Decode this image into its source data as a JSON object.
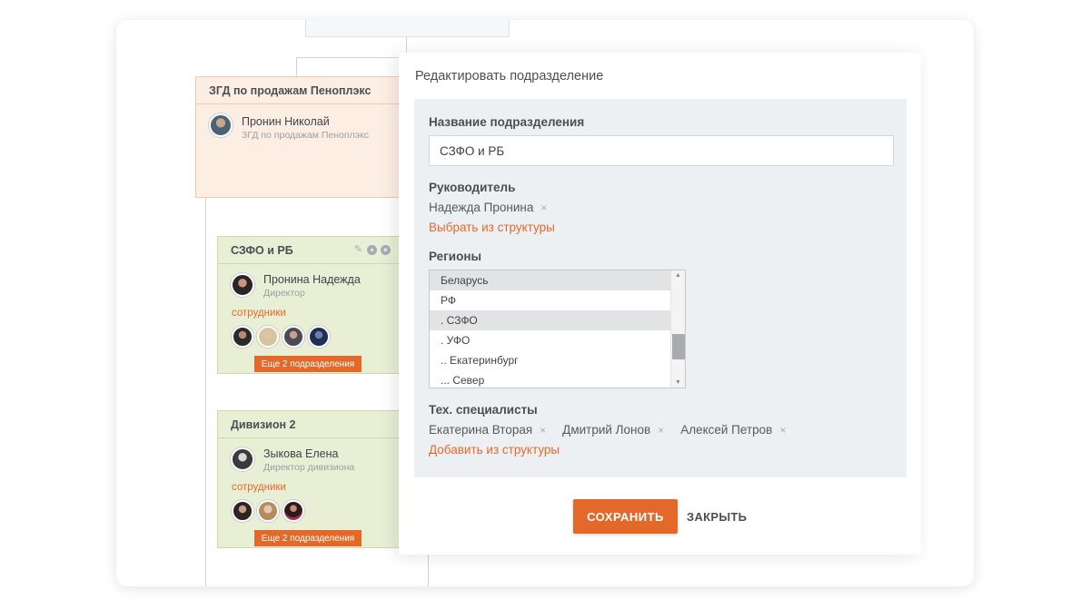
{
  "chart_cards": {
    "head_card": {
      "title": "ЗГД по продажам Пеноплэкс",
      "person_name": "Пронин Николай",
      "person_role": "ЗГД по продажам Пеноплэкс"
    },
    "card1": {
      "title": "СЗФО и РБ",
      "person_name": "Пронина Надежда",
      "person_role": "Директор",
      "staff_label": "сотрудники",
      "more_label": "Еще 2 подразделения",
      "staff_count": 4
    },
    "card2": {
      "title": "Дивизион 2",
      "person_name": "Зыкова Елена",
      "person_role": "Директор дивизиона",
      "staff_label": "сотрудники",
      "more_label": "Еще 2 подразделения",
      "staff_count": 3
    }
  },
  "modal": {
    "title": "Редактировать подразделение",
    "name_label": "Название подразделения",
    "name_value": "СЗФО и РБ",
    "head_label": "Руководитель",
    "head_value": "Надежда Пронина",
    "head_link": "Выбрать из структуры",
    "regions_label": "Регионы",
    "regions": [
      "Беларусь",
      "РФ",
      ". СЗФО",
      ". УФО",
      ".. Екатеринбург",
      "... Север"
    ],
    "tech_label": "Тех. специалисты",
    "tech_people": [
      "Екатерина Вторая",
      "Дмитрий Лонов",
      "Алексей Петров"
    ],
    "tech_link": "Добавить из структуры",
    "remove_symbol": "×",
    "save_label": "СОХРАНИТЬ",
    "close_label": "ЗАКРЫТЬ"
  },
  "colors": {
    "accent": "#e3692b",
    "head_card_bg": "#fdeee4",
    "division_card_bg": "#e9efd5",
    "panel_bg": "#edf0f3"
  }
}
